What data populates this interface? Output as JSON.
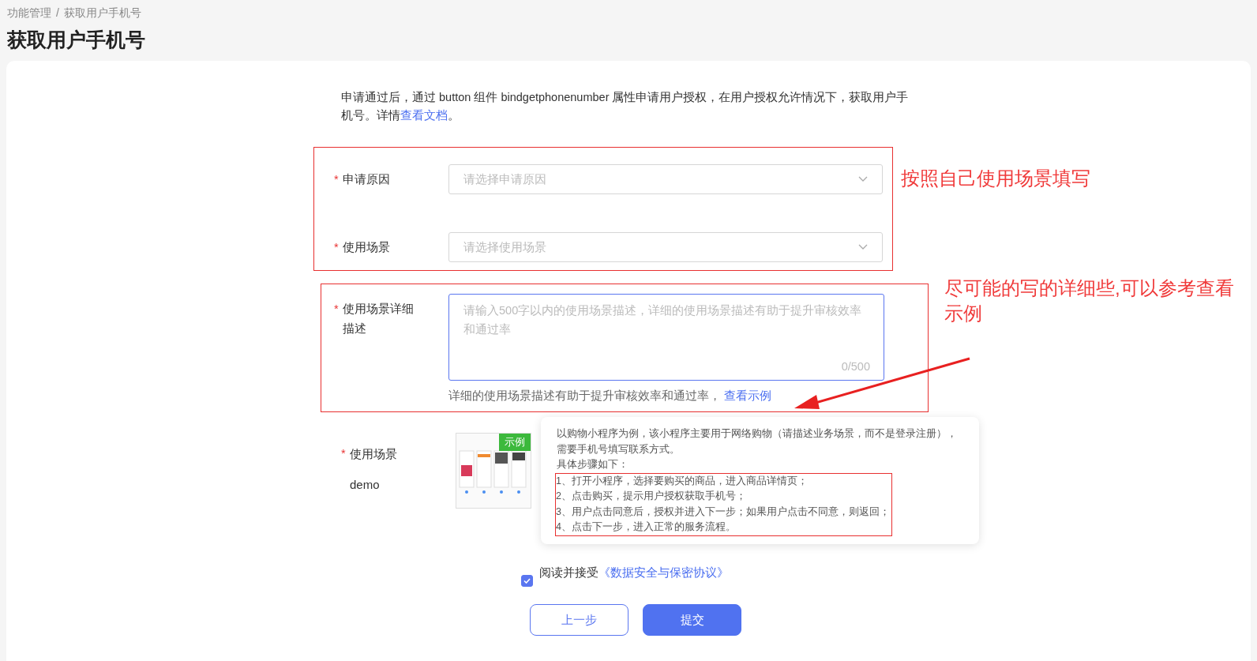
{
  "breadcrumb": {
    "items": [
      "功能管理",
      "获取用户手机号"
    ],
    "separator": "/"
  },
  "title": "获取用户手机号",
  "intro": {
    "text": "申请通过后，通过 button 组件 bindgetphonenumber 属性申请用户授权，在用户授权允许情况下，获取用户手机号。详情",
    "link": "查看文档",
    "end": "。"
  },
  "required_mark": "*",
  "fields": [
    {
      "kind": "select",
      "label": "申请原因",
      "required": true,
      "placeholder": "请选择申请原因"
    },
    {
      "kind": "select",
      "label": "使用场景",
      "required": true,
      "placeholder": "请选择使用场景"
    },
    {
      "kind": "textarea",
      "label": "使用场景详细描述",
      "required": true,
      "focused": true,
      "placeholder": "请输入500字以内的使用场景描述，详细的使用场景描述有助于提升审核效率和通过率",
      "counter": "0/500",
      "help": "详细的使用场景描述有助于提升审核效率和通过率，",
      "help_link": "查看示例"
    },
    {
      "kind": "example",
      "label": "使用场景",
      "required": true,
      "value": "demo",
      "badge": "示例"
    }
  ],
  "annotations": [
    "按照自己使用场景填写",
    "尽可能的写的详细些,可以参考查看示例"
  ],
  "popover": {
    "lines": [
      "以购物小程序为例，该小程序主要用于网络购物（请描述业务场景，而不是登录注册），需要手机号填写联系方式。",
      "具体步骤如下："
    ],
    "steps": [
      "1、打开小程序，选择要购买的商品，进入商品详情页；",
      "2、点击购买，提示用户授权获取手机号；",
      "3、用户点击同意后，授权并进入下一步；如果用户点击不同意，则返回；",
      "4、点击下一步，进入正常的服务流程。"
    ]
  },
  "agreement": {
    "checked": true,
    "text": "阅读并接受",
    "link": "《数据安全与保密协议》"
  },
  "buttons": [
    {
      "label": "上一步",
      "kind": "secondary"
    },
    {
      "label": "提交",
      "kind": "primary"
    }
  ]
}
